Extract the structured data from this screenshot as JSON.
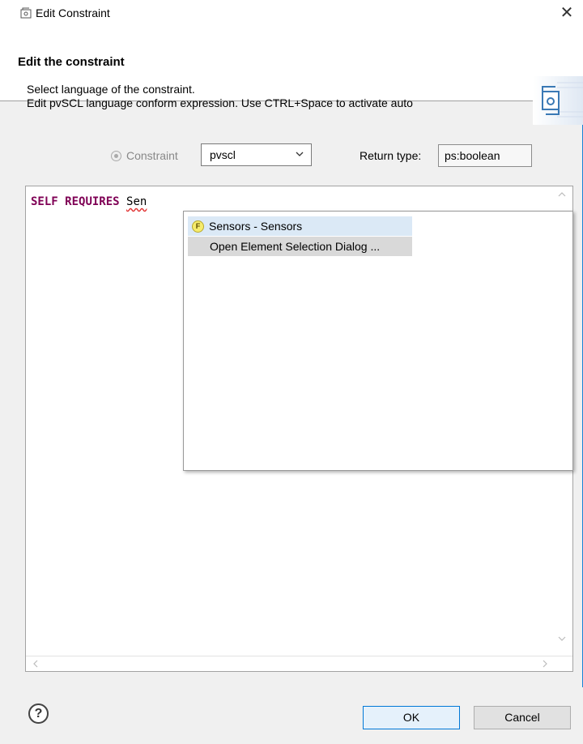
{
  "window": {
    "title": "Edit Constraint",
    "close_symbol": "✕",
    "title_icon": "constraint-wizard-icon"
  },
  "header": {
    "title": "Edit the constraint",
    "description_line1": "Select language of the constraint.",
    "description_line2": "Edit pvSCL language conform expression. Use CTRL+Space to activate auto",
    "graphic_icon": "constraint-wizard-graphic"
  },
  "form": {
    "constraint_label": "Constraint",
    "language_value": "pvscl",
    "return_type_label": "Return type:",
    "return_type_value": "ps:boolean"
  },
  "editor": {
    "kw_self": "SELF",
    "kw_requires": "REQUIRES",
    "typed_text": "Sen"
  },
  "autocomplete": {
    "items": [
      {
        "label": "Sensors - Sensors",
        "icon": "feature-f-icon",
        "badge": "F"
      },
      {
        "label": "Open Element Selection Dialog ..."
      }
    ]
  },
  "footer": {
    "help_symbol": "?",
    "ok_label": "OK",
    "cancel_label": "Cancel"
  },
  "colors": {
    "keyword": "#7f0055",
    "accent": "#0078d7",
    "selection": "#dbe9f6"
  }
}
